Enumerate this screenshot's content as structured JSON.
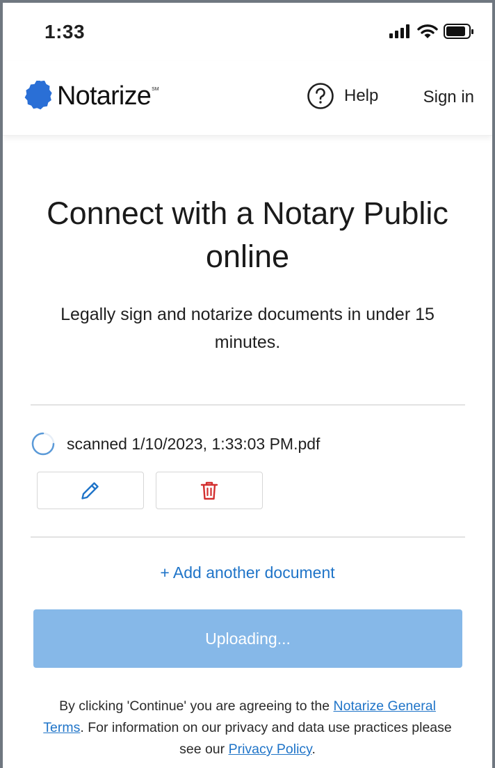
{
  "status_bar": {
    "time": "1:33"
  },
  "header": {
    "brand": "Notarize",
    "brand_mark": "SM",
    "help_label": "Help",
    "signin_label": "Sign in"
  },
  "main": {
    "title": "Connect with a Notary Public online",
    "subtitle": "Legally sign and notarize documents in under 15 minutes.",
    "document": {
      "name": "scanned 1/10/2023, 1:33:03 PM.pdf",
      "status": "uploading"
    },
    "add_document_label": "+ Add another document",
    "upload_button_label": "Uploading...",
    "terms": {
      "part1": "By clicking 'Continue' you are agreeing to the ",
      "general_terms_link": "Notarize General Terms",
      "part2": ". For information on our privacy and data use practices please see our ",
      "privacy_link": "Privacy Policy",
      "part3": "."
    }
  },
  "colors": {
    "brand_blue": "#2a6fd6",
    "link_blue": "#1f74c8",
    "button_disabled_blue": "#86b8e8",
    "delete_red": "#d32f2f"
  },
  "icons": {
    "help": "question-circle-icon",
    "edit": "pencil-icon",
    "delete": "trash-icon",
    "spinner": "loading-spinner-icon"
  }
}
